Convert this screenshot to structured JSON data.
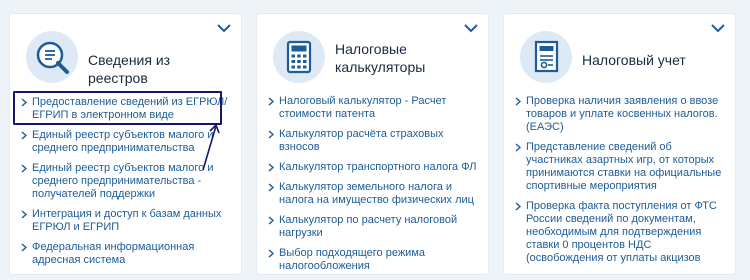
{
  "cards": [
    {
      "title": "Сведения из реестров",
      "icon": "search-document-icon",
      "links": [
        "Предоставление сведений из ЕГРЮЛ/ ЕГРИП в электронном виде",
        "Единый реестр субъектов малого и среднего предпринимательства",
        "Единый реестр субъектов малого и среднего предпринимательства - получателей поддержки",
        "Интеграция и доступ к базам данных ЕГРЮЛ и ЕГРИП",
        "Федеральная информационная адресная система"
      ]
    },
    {
      "title": "Налоговые калькуляторы",
      "icon": "calculator-icon",
      "links": [
        "Налоговый калькулятор - Расчет стоимости патента",
        "Калькулятор расчёта страховых взносов",
        "Калькулятор транспортного налога ФЛ",
        "Калькулятор земельного налога и налога на имущество физических лиц",
        "Калькулятор по расчету налоговой нагрузки",
        "Выбор подходящего режима налогообложения"
      ]
    },
    {
      "title": "Налоговый учет",
      "icon": "tax-document-icon",
      "links": [
        "Проверка наличия заявления о ввозе товаров и уплате косвенных налогов. (ЕАЭС)",
        "Представление сведений об участниках азартных игр, от которых принимаются ставки на официальные спортивные мероприятия",
        "Проверка факта поступления от ФТС России сведений по документам, необходимым для подтверждения ставки 0 процентов НДС (освобождения от уплаты акцизов"
      ]
    }
  ],
  "colors": {
    "link": "#1d5c97",
    "accent": "#1d5c97",
    "highlight": "#16166e",
    "background": "#eef3f8"
  }
}
